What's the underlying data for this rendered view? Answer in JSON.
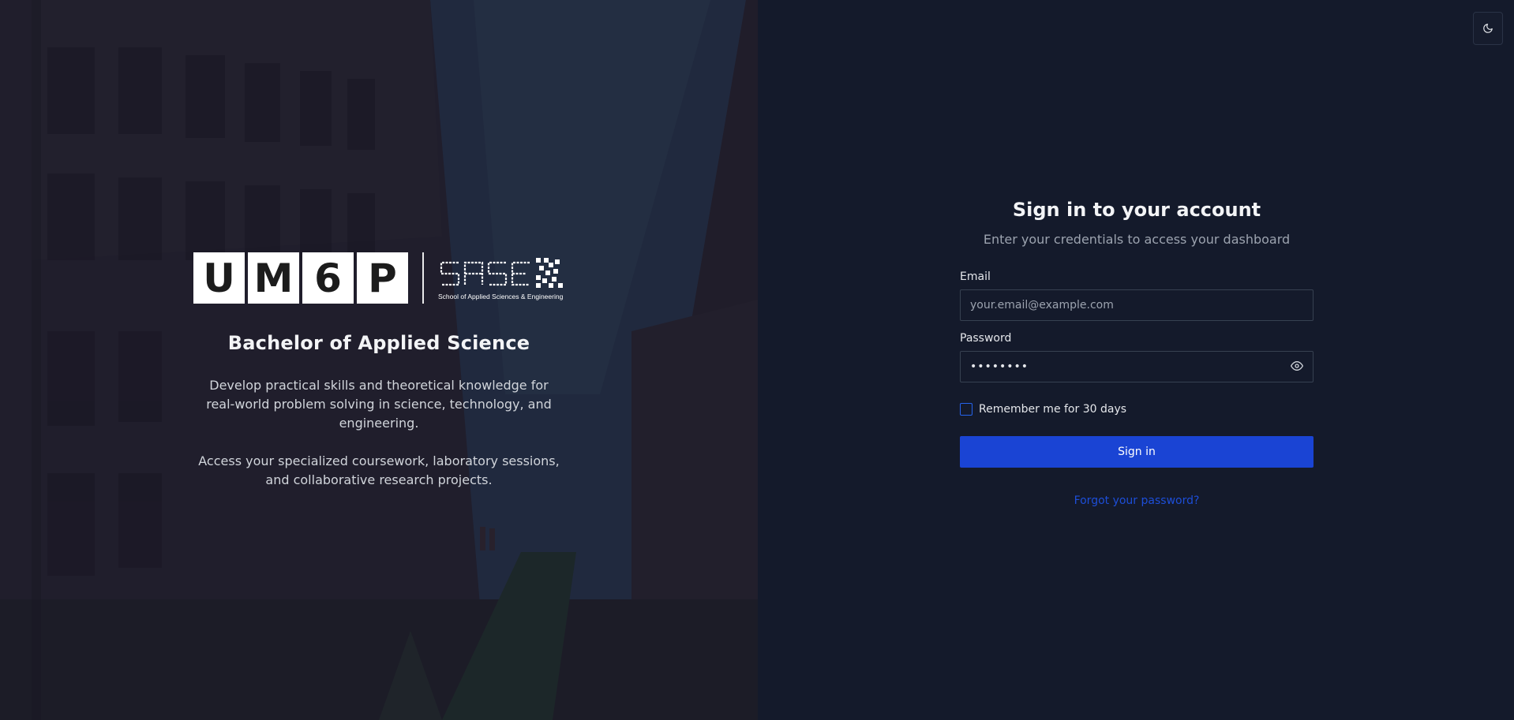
{
  "hero": {
    "logo_letters": [
      "U",
      "M",
      "6",
      "P"
    ],
    "sase_subtitle": "School of Applied Sciences & Engineering",
    "title": "Bachelor of Applied Science",
    "paragraph1": "Develop practical skills and theoretical knowledge for real-world problem solving in science, technology, and engineering.",
    "paragraph2": "Access your specialized coursework, laboratory sessions, and collaborative research projects."
  },
  "form": {
    "title": "Sign in to your account",
    "subtitle": "Enter your credentials to access your dashboard",
    "email_label": "Email",
    "email_placeholder": "your.email@example.com",
    "password_label": "Password",
    "password_value": "••••••••",
    "remember_label": "Remember me for 30 days",
    "signin_label": "Sign in",
    "forgot_label": "Forgot your password?"
  },
  "icons": {
    "theme_toggle": "moon-icon",
    "password_visibility": "eye-icon"
  },
  "colors": {
    "background": "#141a2b",
    "primary_button": "#1a44d4",
    "link": "#1d4ed8"
  }
}
